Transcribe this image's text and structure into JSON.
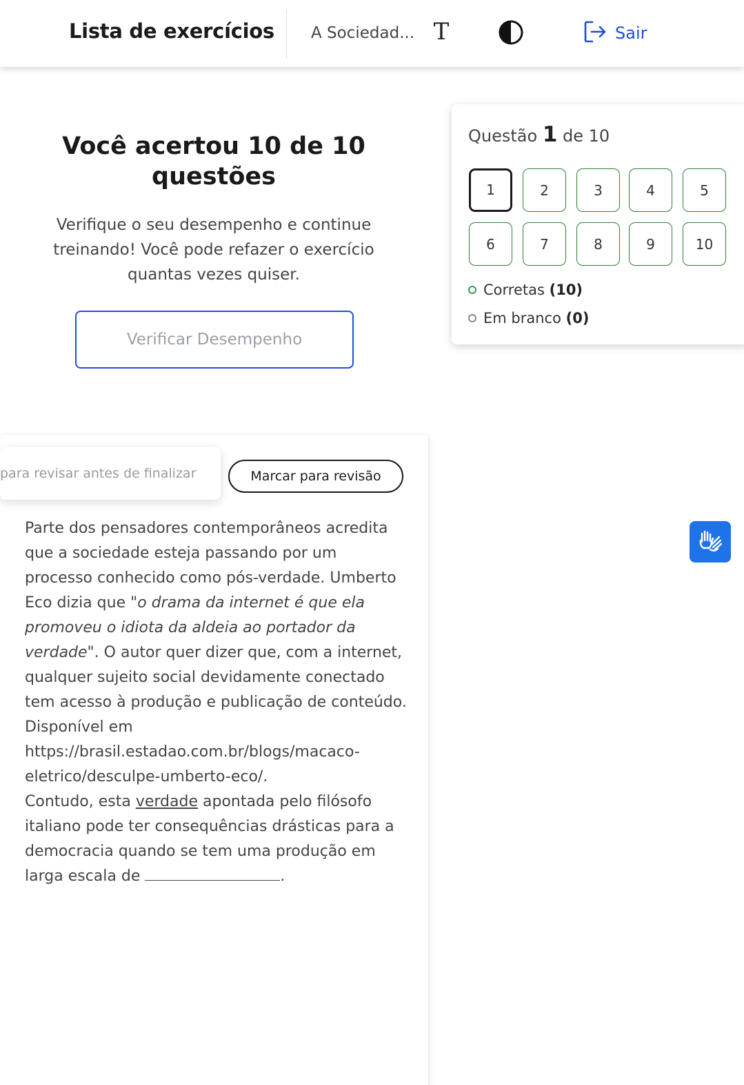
{
  "header": {
    "title": "Lista de exercícios",
    "subtitle": "A Sociedad...",
    "font_size_glyph": "T",
    "logout_label": "Sair"
  },
  "result": {
    "title": "Você acertou 10 de 10 questões",
    "description": "Verifique o seu desempenho e continue treinando! Você pode refazer o exercício quantas vezes quiser.",
    "verify_button": "Verificar Desempenho"
  },
  "navigator": {
    "heading_prefix": "Questão",
    "current": "1",
    "heading_suffix": "de 10",
    "questions": [
      "1",
      "2",
      "3",
      "4",
      "5",
      "6",
      "7",
      "8",
      "9",
      "10"
    ],
    "correct_label": "Corretas",
    "correct_count": "(10)",
    "blank_label": "Em branco",
    "blank_count": "(0)"
  },
  "question": {
    "tooltip": "para revisar antes de finalizar",
    "review_button": "Marcar para revisão",
    "p1_a": "Parte dos pensadores contemporâneos acredita que a sociedade esteja passando por um processo conhecido como pós-verdade. Umberto Eco dizia que ",
    "p1_quote": "\"o drama da internet é que ela promoveu o idiota da aldeia ao portador da verdade\"",
    "p1_b": ". O autor quer dizer que, com a internet, qualquer sujeito social devidamente conectado tem acesso à produção e publicação de conteúdo.",
    "source": "Disponível em https://brasil.estadao.com.br/blogs/macaco-eletrico/desculpe-umberto-eco/.",
    "p2_a": "Contudo, esta ",
    "p2_underlined": "verdade",
    "p2_b": " apontada pelo filósofo italiano pode ter consequências drásticas para a democracia quando se tem uma produção em larga escala de ",
    "p2_end": "."
  },
  "colors": {
    "accent_blue": "#1d4ed8",
    "correct_green": "#2e7d32",
    "vlibras_blue": "#1e73e8"
  },
  "icons": {
    "font_size": "text-size-icon",
    "contrast": "contrast-icon",
    "logout": "logout-icon",
    "accessibility": "sign-language-hands-icon"
  }
}
